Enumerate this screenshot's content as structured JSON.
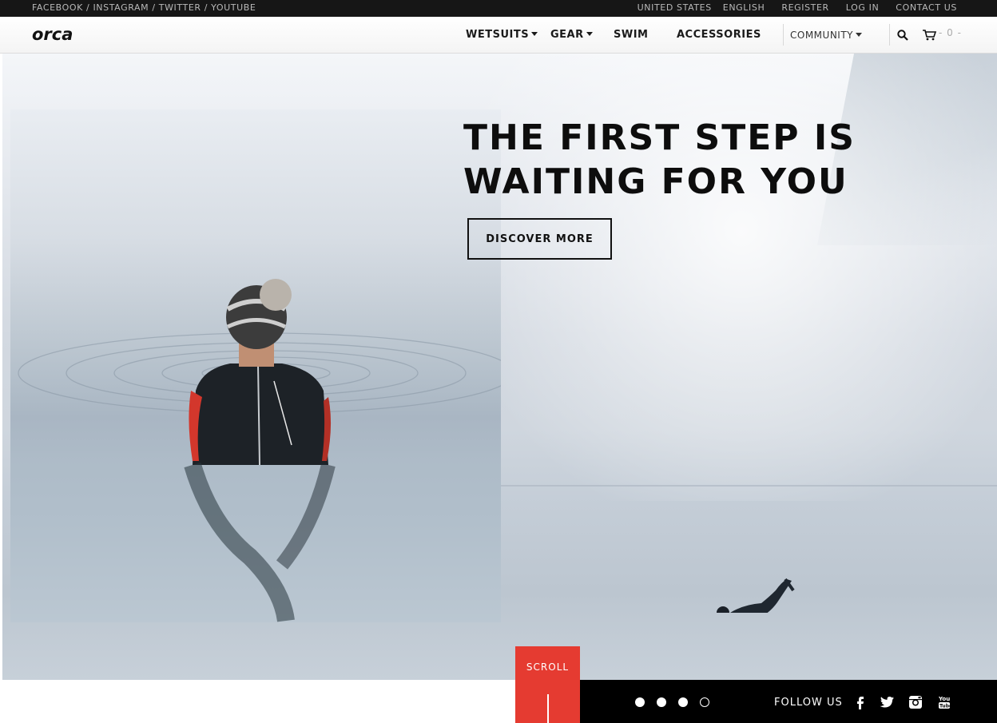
{
  "topbar": {
    "social_links": "FACEBOOK / INSTAGRAM / TWITTER / YOUTUBE",
    "country": "UNITED STATES",
    "language": "ENGLISH",
    "register": "REGISTER",
    "login": "LOG IN",
    "contact": "CONTACT US"
  },
  "nav": {
    "logo": "orca",
    "items": [
      "WETSUITS",
      "GEAR",
      "SWIM",
      "ACCESSORIES"
    ],
    "community": "COMMUNITY",
    "cart_count": "- 0 -"
  },
  "hero": {
    "headline_line1": "THE FIRST STEP IS",
    "headline_line2": "WAITING FOR YOU",
    "cta": "DISCOVER MORE"
  },
  "bottom": {
    "scroll": "SCROLL",
    "follow": "FOLLOW US",
    "slides": 4,
    "active_slide": 4
  },
  "icons": [
    "search-icon",
    "cart-icon",
    "facebook-icon",
    "twitter-icon",
    "instagram-icon",
    "youtube-icon"
  ],
  "colors": {
    "accent": "#e53b31",
    "topbar": "#161616"
  }
}
